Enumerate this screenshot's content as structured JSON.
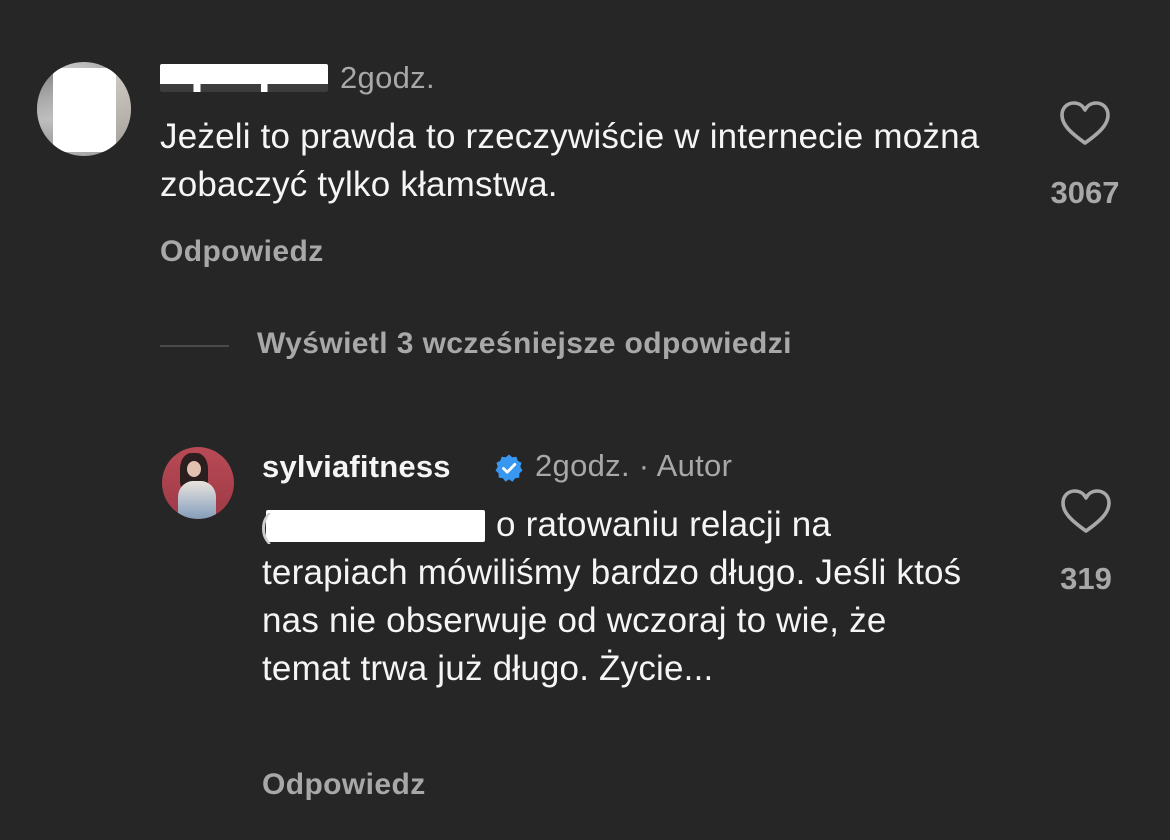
{
  "comment": {
    "time": "2godz.",
    "text": "Jeżeli to prawda to rzeczywiście w internecie można zobaczyć tylko kłamstwa.",
    "reply_label": "Odpowiedz",
    "like_count": "3067",
    "like_icon": "heart-outline-icon"
  },
  "view_replies": {
    "label": "Wyświetl 3 wcześniejsze odpowiedzi"
  },
  "reply": {
    "username": "sylviafitness",
    "verified_icon": "verified-badge-icon",
    "verified_color": "#3897f0",
    "time": "2godz. · Autor",
    "text": "o ratowaniu relacji na terapiach mówiliśmy bardzo długo. Jeśli ktoś nas nie obserwuje od wczoraj to wie, że temat trwa już długo. Życie...",
    "reply_label": "Odpowiedz",
    "like_count": "319",
    "like_icon": "heart-outline-icon"
  },
  "colors": {
    "background": "#262626",
    "primary_text": "#f5f5f5",
    "secondary_text": "#a8a8a8"
  }
}
